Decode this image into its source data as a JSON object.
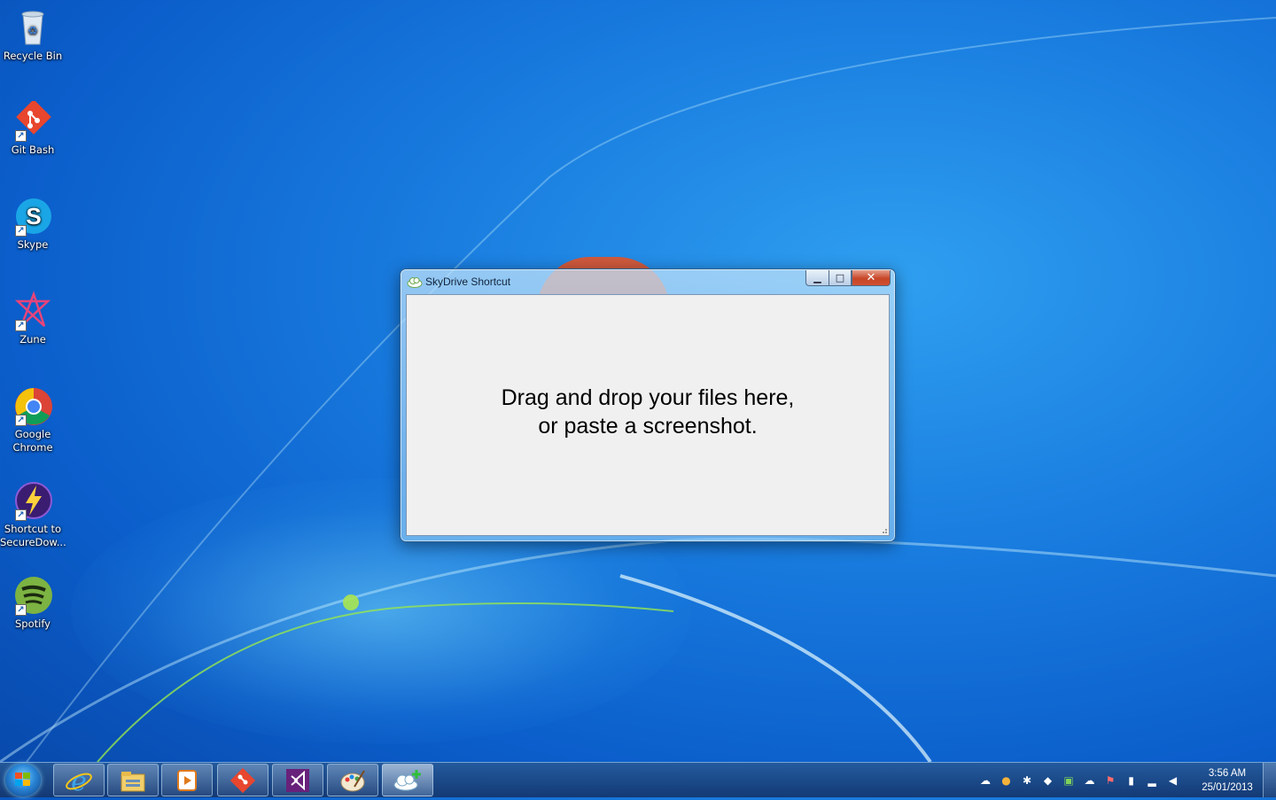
{
  "desktop": {
    "icons": [
      {
        "label": "Recycle Bin",
        "icon": "recycle-bin-icon"
      },
      {
        "label": "Git Bash",
        "icon": "git-bash-icon"
      },
      {
        "label": "Skype",
        "icon": "skype-icon"
      },
      {
        "label": "Zune",
        "icon": "zune-icon"
      },
      {
        "label": "Google Chrome",
        "icon": "chrome-icon"
      },
      {
        "label": "Shortcut to SecureDow...",
        "icon": "securedownload-icon"
      },
      {
        "label": "Spotify",
        "icon": "spotify-icon"
      }
    ]
  },
  "window": {
    "title": "SkyDrive Shortcut",
    "message_line1": "Drag and drop your files here,",
    "message_line2": "or paste a screenshot.",
    "minimize_glyph": "▁",
    "maximize_glyph": "□",
    "close_glyph": "✕"
  },
  "taskbar": {
    "pinned": [
      "internet-explorer-icon",
      "windows-explorer-icon",
      "media-player-icon",
      "git-icon",
      "visual-studio-icon",
      "paint-icon",
      "skydrive-shortcut-icon"
    ],
    "active": "skydrive-shortcut-icon",
    "clock": {
      "time": "3:56 AM",
      "date": "25/01/2013"
    }
  }
}
